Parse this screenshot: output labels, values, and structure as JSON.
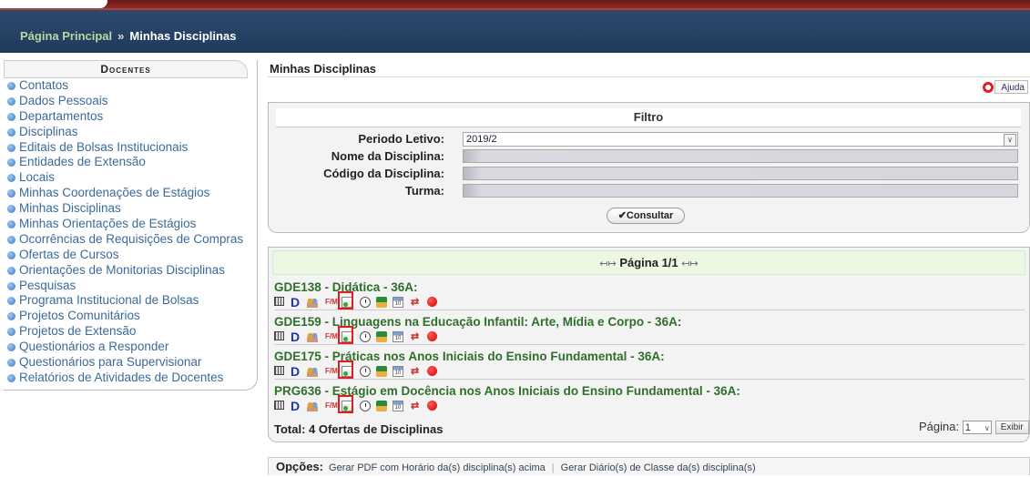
{
  "breadcrumb": {
    "home": "Página Principal",
    "separator": "»",
    "current": "Minhas Disciplinas"
  },
  "sidebar": {
    "title": "Docentes",
    "items": [
      "Contatos",
      "Dados Pessoais",
      "Departamentos",
      "Disciplinas",
      "Editais de Bolsas Institucionais",
      "Entidades de Extensão",
      "Locais",
      "Minhas Coordenações de Estágios",
      "Minhas Disciplinas",
      "Minhas Orientações de Estágios",
      "Ocorrências de Requisições de Compras",
      "Ofertas de Cursos",
      "Orientações de Monitorias Disciplinas",
      "Pesquisas",
      "Programa Institucional de Bolsas",
      "Projetos Comunitários",
      "Projetos de Extensão",
      "Questionários a Responder",
      "Questionários para Supervisionar",
      "Relatórios de Atividades de Docentes"
    ]
  },
  "main": {
    "title": "Minhas Disciplinas",
    "help_label": "Ajuda",
    "filter": {
      "title": "Filtro",
      "periodo_label": "Periodo Letivo:",
      "periodo_value": "2019/2",
      "nome_label": "Nome da Disciplina:",
      "codigo_label": "Código da Disciplina:",
      "turma_label": "Turma:",
      "consult_label": "✔Consultar"
    },
    "results": {
      "page_label": "Página 1/1",
      "courses": [
        "GDE138 - Didática - 36A:",
        "GDE159 - Linguagens na Educação Infantil: Arte, Mídia e Corpo - 36A:",
        "GDE175 - Práticas nos Anos Iniciais do Ensino Fundamental - 36A:",
        "PRG636 - Estágio em Docência nos Anos Iniciais do Ensino Fundamental - 36A:"
      ],
      "total": "Total: 4 Ofertas de Disciplinas",
      "pagina_label": "Página:",
      "pagina_value": "1",
      "exibir_label": "Exibir"
    },
    "options": {
      "label": "Opções:",
      "link1": "Gerar PDF com Horário da(s) disciplina(s) acima",
      "link2": "Gerar Diário(s) de Classe da(s) disciplina(s)"
    }
  }
}
